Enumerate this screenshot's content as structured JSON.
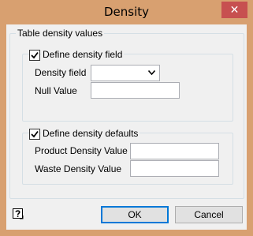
{
  "window": {
    "title": "Density",
    "close_glyph": "✕"
  },
  "table_group": {
    "label": "Table density values"
  },
  "field_group": {
    "checkbox_label": "Define density field",
    "checked": true,
    "density_field_label": "Density field",
    "density_field_value": "",
    "null_value_label": "Null Value",
    "null_value_value": ""
  },
  "defaults_group": {
    "checkbox_label": "Define density defaults",
    "checked": true,
    "product_label": "Product Density Value",
    "product_value": "",
    "waste_label": "Waste Density Value",
    "waste_value": ""
  },
  "buttons": {
    "ok": "OK",
    "cancel": "Cancel"
  },
  "icons": {
    "close": "close-icon",
    "help": "help-icon",
    "dropdown": "chevron-down-icon",
    "check": "check-icon"
  },
  "colors": {
    "frame": "#d8a070",
    "close": "#c75050",
    "focus": "#0078d7"
  }
}
